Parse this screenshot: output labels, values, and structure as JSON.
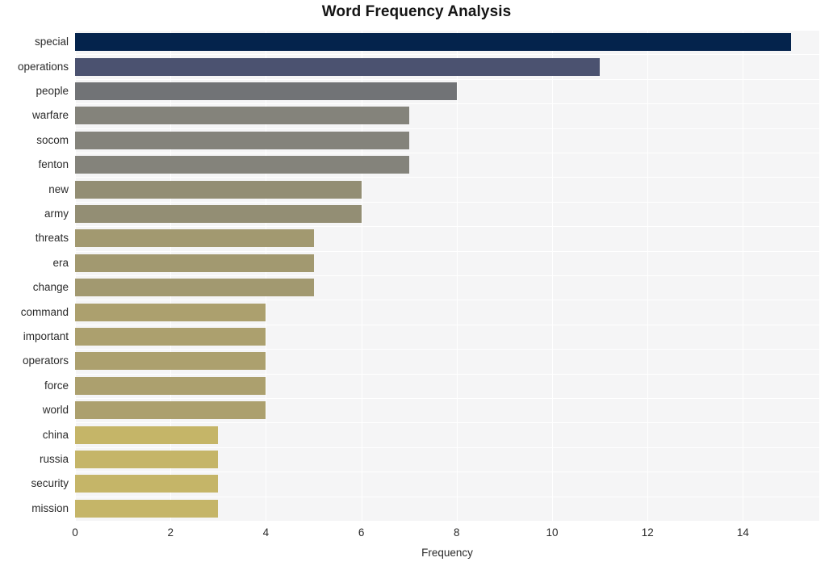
{
  "chart_data": {
    "type": "bar",
    "orientation": "horizontal",
    "title": "Word Frequency Analysis",
    "xlabel": "Frequency",
    "ylabel": "",
    "categories": [
      "special",
      "operations",
      "people",
      "warfare",
      "socom",
      "fenton",
      "new",
      "army",
      "threats",
      "era",
      "change",
      "command",
      "important",
      "operators",
      "force",
      "world",
      "china",
      "russia",
      "security",
      "mission"
    ],
    "values": [
      15,
      11,
      8,
      7,
      7,
      7,
      6,
      6,
      5,
      5,
      5,
      4,
      4,
      4,
      4,
      4,
      3,
      3,
      3,
      3
    ],
    "bar_colors": [
      "#04234c",
      "#4b5270",
      "#717376",
      "#84837b",
      "#84837b",
      "#84837b",
      "#938e74",
      "#938e74",
      "#a29970",
      "#a29970",
      "#a29970",
      "#aca06e",
      "#aca06e",
      "#aca06e",
      "#aca06e",
      "#aca06e",
      "#c5b568",
      "#c5b568",
      "#c5b568",
      "#c5b568"
    ],
    "xlim": [
      0,
      15.6
    ],
    "xticks": [
      0,
      2,
      4,
      6,
      8,
      10,
      12,
      14
    ],
    "xtick_labels": [
      "0",
      "2",
      "4",
      "6",
      "8",
      "10",
      "12",
      "14"
    ],
    "grid": true,
    "grid_color": "#ffffff",
    "plot_background": "#f5f5f6",
    "figure_background": "#ffffff",
    "legend": null,
    "colormap": "cividis"
  }
}
